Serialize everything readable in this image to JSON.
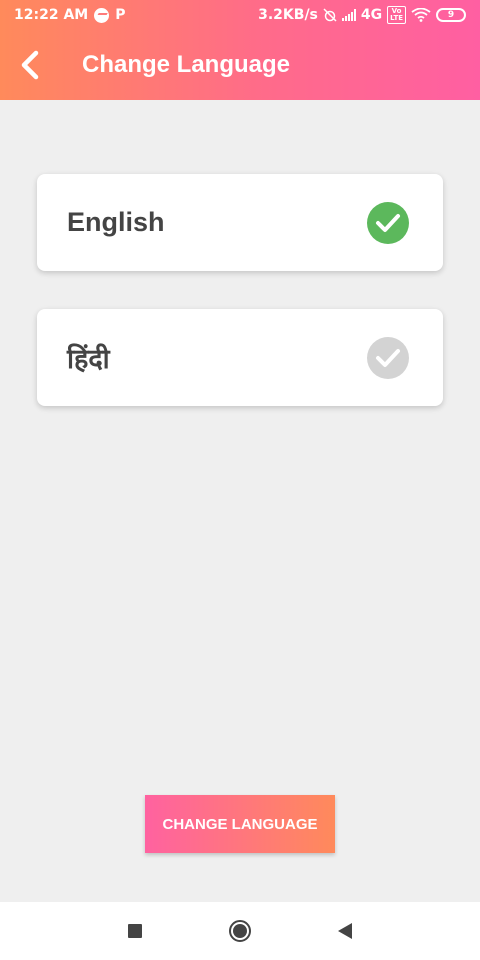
{
  "status_bar": {
    "time": "12:22 AM",
    "p_icon": "P",
    "net_speed": "3.2KB/s",
    "network": "4G",
    "volte_line1": "Vo",
    "volte_line2": "LTE",
    "battery": "9"
  },
  "header": {
    "title": "Change Language",
    "back_icon": "chevron-left-icon"
  },
  "languages": [
    {
      "label": "English",
      "selected": true
    },
    {
      "label": "हिंदी",
      "selected": false
    }
  ],
  "change_button": {
    "label": "CHANGE LANGUAGE"
  },
  "nav_bar": {
    "icons": [
      "recents-square-icon",
      "home-circle-icon",
      "back-triangle-icon"
    ]
  },
  "colors": {
    "header_start": "#ff8a5b",
    "header_end": "#ff5fa2",
    "check_selected": "#5cb85c",
    "check_unselected": "#d3d3d3",
    "background": "#efefef"
  }
}
